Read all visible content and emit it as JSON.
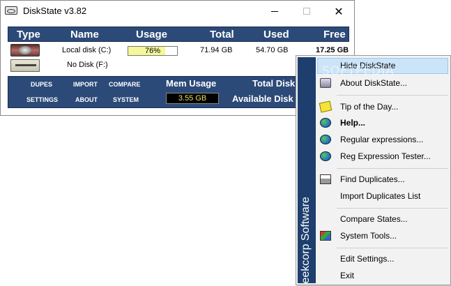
{
  "window": {
    "title": "DiskState v3.82",
    "controls": {
      "minimize": "",
      "maximize": "",
      "close": "✕"
    }
  },
  "table": {
    "headers": {
      "type": "Type",
      "name": "Name",
      "usage": "Usage",
      "total": "Total",
      "used": "Used",
      "free": "Free"
    },
    "rows": [
      {
        "icon": "hard-disk-icon",
        "name": "Local disk (C:)",
        "usage_label": "76%",
        "usage_fraction": 0.76,
        "total": "71.94 GB",
        "used": "54.70 GB",
        "free": "17.25 GB"
      },
      {
        "icon": "floppy-disk-icon",
        "name": "No Disk (F:)",
        "usage_label": "",
        "total": "",
        "used": "",
        "free": ""
      }
    ]
  },
  "panel": {
    "buttons": [
      "DUPES",
      "IMPORT",
      "COMPARE",
      "SETTINGS",
      "ABOUT",
      "SYSTEM"
    ],
    "mem_usage_label": "Mem Usage",
    "mem_usage_value": "3.55 GB",
    "total_disk_label": "Total Disk",
    "available_disk_label": "Available Disk"
  },
  "menu": {
    "banner": "Geekcorp Software",
    "watermark": "SOFTPEDIA",
    "items": [
      {
        "label": "Hide DiskState",
        "icon": "",
        "bold": false,
        "hover": true
      },
      {
        "label": "About DiskState...",
        "icon": "about-icon"
      },
      {
        "label": "Tip of the Day...",
        "icon": "tip-icon"
      },
      {
        "label": "Help...",
        "icon": "help-globe-icon",
        "bold": true
      },
      {
        "label": "Regular expressions...",
        "icon": "globe-icon"
      },
      {
        "label": "Reg Expression Tester...",
        "icon": "globe-icon"
      },
      {
        "label": "Find Duplicates...",
        "icon": "printer-icon"
      },
      {
        "label": "Import Duplicates List",
        "icon": ""
      },
      {
        "label": "Compare States...",
        "icon": ""
      },
      {
        "label": "System Tools...",
        "icon": "tools-icon"
      },
      {
        "label": "Edit Settings...",
        "icon": ""
      },
      {
        "label": "Exit",
        "icon": ""
      }
    ]
  },
  "colors": {
    "panel_blue": "#2c4a78",
    "usage_fill": "#f4f79a",
    "mem_value": "#f0e060",
    "menu_hover": "#cce4f7"
  }
}
